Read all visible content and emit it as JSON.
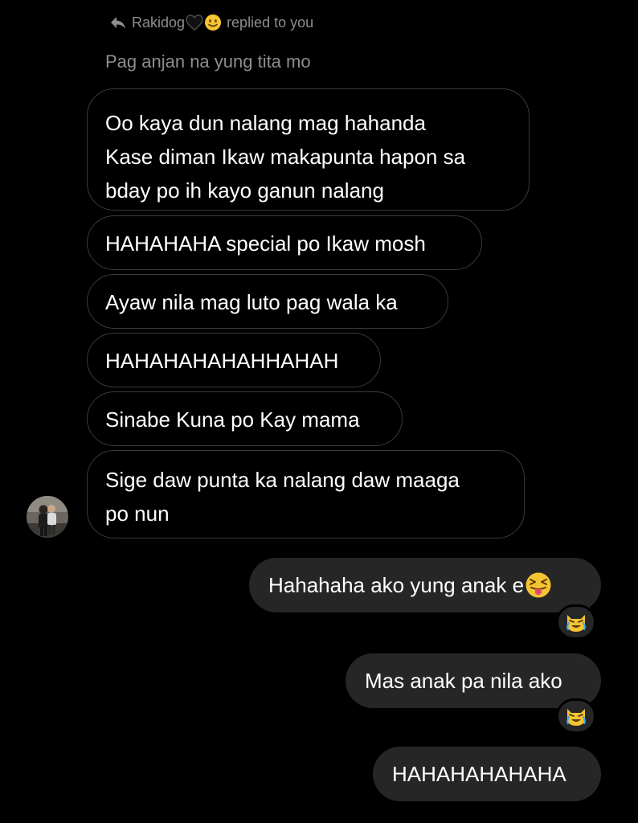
{
  "reply": {
    "sender": "Rakidog",
    "suffix": "replied to you",
    "quoted": "Pag anjan na yung tita mo"
  },
  "incoming": [
    {
      "text": "Oo kaya dun nalang mag hahanda\nKase diman Ikaw makapunta hapon sa\nbday po ih kayo ganun nalang"
    },
    {
      "text": "HAHAHAHA special po Ikaw mosh"
    },
    {
      "text": "Ayaw nila mag luto pag wala ka"
    },
    {
      "text": "HAHAHAHAHAHHAHAH"
    },
    {
      "text": "Sinabe Kuna po Kay mama"
    },
    {
      "text": "Sige daw punta ka nalang daw maaga\npo nun"
    }
  ],
  "outgoing": [
    {
      "text": "Hahahaha ako yung anak e",
      "emoji": "squinting-face-with-tongue",
      "reaction": "crying-cat-face"
    },
    {
      "text": "Mas anak pa nila ako",
      "reaction": "crying-cat-face"
    },
    {
      "text": "HAHAHAHAHAHA"
    }
  ],
  "colors": {
    "background": "#000000",
    "outgoing_bubble": "#262626",
    "incoming_border": "#3a3a3a",
    "muted_text": "#8e8e8e"
  },
  "icons": {
    "reply": "reply-arrow-icon",
    "heart": "black-heart-icon",
    "smile": "smiling-face-icon",
    "reaction": "crying-cat-face-icon"
  }
}
